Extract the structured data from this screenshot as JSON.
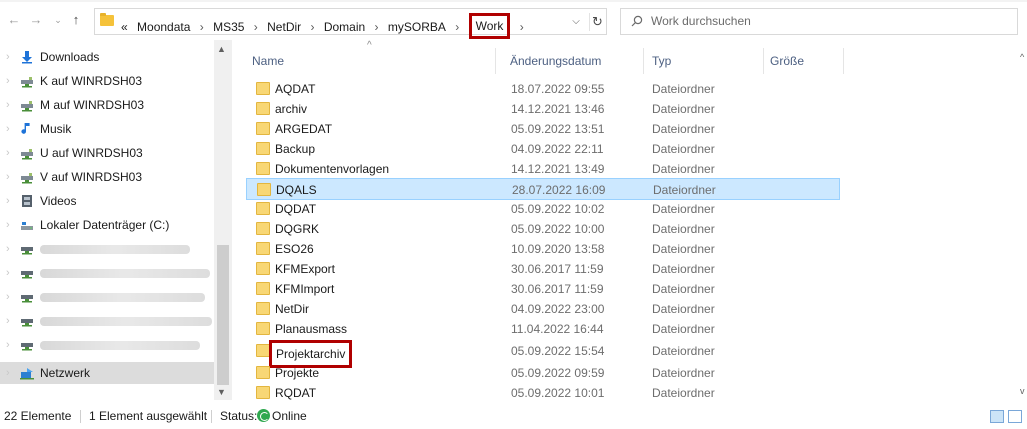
{
  "address": {
    "crumbs": [
      "«",
      "Moondata",
      "MS35",
      "NetDir",
      "Domain",
      "mySORBA",
      "Work"
    ],
    "highlighted_crumb": "Work"
  },
  "search": {
    "placeholder": "Work durchsuchen"
  },
  "navpane": {
    "items": [
      {
        "label": "Downloads",
        "icon": "download-arrow-icon"
      },
      {
        "label": "K auf WINRDSH03",
        "icon": "network-drive-icon"
      },
      {
        "label": "M auf WINRDSH03",
        "icon": "network-drive-icon"
      },
      {
        "label": "Musik",
        "icon": "music-note-icon"
      },
      {
        "label": "U auf WINRDSH03",
        "icon": "network-drive-icon"
      },
      {
        "label": "V auf WINRDSH03",
        "icon": "network-drive-icon"
      },
      {
        "label": "Videos",
        "icon": "video-film-icon"
      },
      {
        "label": "Lokaler Datenträger (C:)",
        "icon": "local-disk-icon"
      },
      {
        "label": "",
        "icon": "network-drive-icon",
        "redacted": true
      },
      {
        "label": "",
        "icon": "network-drive-icon",
        "redacted": true
      },
      {
        "label": "",
        "icon": "network-drive-icon",
        "redacted": true
      },
      {
        "label": "",
        "icon": "network-drive-icon",
        "redacted": true
      },
      {
        "label": "",
        "icon": "network-drive-icon",
        "redacted": true
      },
      {
        "label": "Netzwerk",
        "icon": "network-icon",
        "selected": true
      }
    ]
  },
  "columns": {
    "name": "Name",
    "date": "Änderungsdatum",
    "type": "Typ",
    "size": "Größe"
  },
  "files": [
    {
      "name": "AQDAT",
      "date": "18.07.2022 09:55",
      "type": "Dateiordner"
    },
    {
      "name": "archiv",
      "date": "14.12.2021 13:46",
      "type": "Dateiordner"
    },
    {
      "name": "ARGEDAT",
      "date": "05.09.2022 13:51",
      "type": "Dateiordner"
    },
    {
      "name": "Backup",
      "date": "04.09.2022 22:11",
      "type": "Dateiordner"
    },
    {
      "name": "Dokumentenvorlagen",
      "date": "14.12.2021 13:49",
      "type": "Dateiordner"
    },
    {
      "name": "DQALS",
      "date": "28.07.2022 16:09",
      "type": "Dateiordner",
      "selected": true
    },
    {
      "name": "DQDAT",
      "date": "05.09.2022 10:02",
      "type": "Dateiordner"
    },
    {
      "name": "DQGRK",
      "date": "05.09.2022 10:00",
      "type": "Dateiordner"
    },
    {
      "name": "ESO26",
      "date": "10.09.2020 13:58",
      "type": "Dateiordner"
    },
    {
      "name": "KFMExport",
      "date": "30.06.2017 11:59",
      "type": "Dateiordner"
    },
    {
      "name": "KFMImport",
      "date": "30.06.2017 11:59",
      "type": "Dateiordner"
    },
    {
      "name": "NetDir",
      "date": "04.09.2022 23:00",
      "type": "Dateiordner"
    },
    {
      "name": "Planausmass",
      "date": "11.04.2022 16:44",
      "type": "Dateiordner"
    },
    {
      "name": "Projektarchiv",
      "date": "05.09.2022 15:54",
      "type": "Dateiordner",
      "highlighted": true
    },
    {
      "name": "Projekte",
      "date": "05.09.2022 09:59",
      "type": "Dateiordner"
    },
    {
      "name": "RQDAT",
      "date": "05.09.2022 10:01",
      "type": "Dateiordner"
    }
  ],
  "status": {
    "count": "22 Elemente",
    "selection": "1 Element ausgewählt",
    "status_label": "Status:",
    "status_value": "Online"
  },
  "colors": {
    "highlight_red": "#b00000",
    "selection_blue": "#cce8ff",
    "folder_yellow": "#f8d775"
  }
}
